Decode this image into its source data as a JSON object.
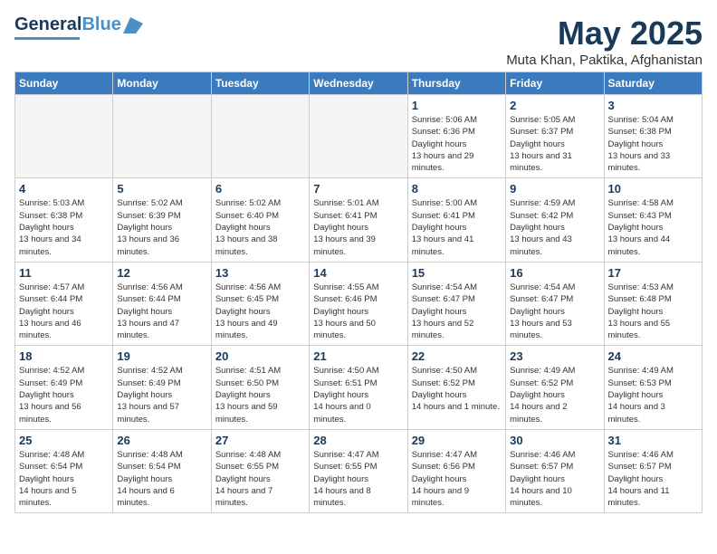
{
  "header": {
    "logo_general": "General",
    "logo_blue": "Blue",
    "month_title": "May 2025",
    "location": "Muta Khan, Paktika, Afghanistan"
  },
  "days_of_week": [
    "Sunday",
    "Monday",
    "Tuesday",
    "Wednesday",
    "Thursday",
    "Friday",
    "Saturday"
  ],
  "weeks": [
    [
      {
        "day": "",
        "empty": true
      },
      {
        "day": "",
        "empty": true
      },
      {
        "day": "",
        "empty": true
      },
      {
        "day": "",
        "empty": true
      },
      {
        "day": "1",
        "sunrise": "5:06 AM",
        "sunset": "6:36 PM",
        "daylight": "13 hours and 29 minutes."
      },
      {
        "day": "2",
        "sunrise": "5:05 AM",
        "sunset": "6:37 PM",
        "daylight": "13 hours and 31 minutes."
      },
      {
        "day": "3",
        "sunrise": "5:04 AM",
        "sunset": "6:38 PM",
        "daylight": "13 hours and 33 minutes."
      }
    ],
    [
      {
        "day": "4",
        "sunrise": "5:03 AM",
        "sunset": "6:38 PM",
        "daylight": "13 hours and 34 minutes."
      },
      {
        "day": "5",
        "sunrise": "5:02 AM",
        "sunset": "6:39 PM",
        "daylight": "13 hours and 36 minutes."
      },
      {
        "day": "6",
        "sunrise": "5:02 AM",
        "sunset": "6:40 PM",
        "daylight": "13 hours and 38 minutes."
      },
      {
        "day": "7",
        "sunrise": "5:01 AM",
        "sunset": "6:41 PM",
        "daylight": "13 hours and 39 minutes."
      },
      {
        "day": "8",
        "sunrise": "5:00 AM",
        "sunset": "6:41 PM",
        "daylight": "13 hours and 41 minutes."
      },
      {
        "day": "9",
        "sunrise": "4:59 AM",
        "sunset": "6:42 PM",
        "daylight": "13 hours and 43 minutes."
      },
      {
        "day": "10",
        "sunrise": "4:58 AM",
        "sunset": "6:43 PM",
        "daylight": "13 hours and 44 minutes."
      }
    ],
    [
      {
        "day": "11",
        "sunrise": "4:57 AM",
        "sunset": "6:44 PM",
        "daylight": "13 hours and 46 minutes."
      },
      {
        "day": "12",
        "sunrise": "4:56 AM",
        "sunset": "6:44 PM",
        "daylight": "13 hours and 47 minutes."
      },
      {
        "day": "13",
        "sunrise": "4:56 AM",
        "sunset": "6:45 PM",
        "daylight": "13 hours and 49 minutes."
      },
      {
        "day": "14",
        "sunrise": "4:55 AM",
        "sunset": "6:46 PM",
        "daylight": "13 hours and 50 minutes."
      },
      {
        "day": "15",
        "sunrise": "4:54 AM",
        "sunset": "6:47 PM",
        "daylight": "13 hours and 52 minutes."
      },
      {
        "day": "16",
        "sunrise": "4:54 AM",
        "sunset": "6:47 PM",
        "daylight": "13 hours and 53 minutes."
      },
      {
        "day": "17",
        "sunrise": "4:53 AM",
        "sunset": "6:48 PM",
        "daylight": "13 hours and 55 minutes."
      }
    ],
    [
      {
        "day": "18",
        "sunrise": "4:52 AM",
        "sunset": "6:49 PM",
        "daylight": "13 hours and 56 minutes."
      },
      {
        "day": "19",
        "sunrise": "4:52 AM",
        "sunset": "6:49 PM",
        "daylight": "13 hours and 57 minutes."
      },
      {
        "day": "20",
        "sunrise": "4:51 AM",
        "sunset": "6:50 PM",
        "daylight": "13 hours and 59 minutes."
      },
      {
        "day": "21",
        "sunrise": "4:50 AM",
        "sunset": "6:51 PM",
        "daylight": "14 hours and 0 minutes."
      },
      {
        "day": "22",
        "sunrise": "4:50 AM",
        "sunset": "6:52 PM",
        "daylight": "14 hours and 1 minute."
      },
      {
        "day": "23",
        "sunrise": "4:49 AM",
        "sunset": "6:52 PM",
        "daylight": "14 hours and 2 minutes."
      },
      {
        "day": "24",
        "sunrise": "4:49 AM",
        "sunset": "6:53 PM",
        "daylight": "14 hours and 3 minutes."
      }
    ],
    [
      {
        "day": "25",
        "sunrise": "4:48 AM",
        "sunset": "6:54 PM",
        "daylight": "14 hours and 5 minutes."
      },
      {
        "day": "26",
        "sunrise": "4:48 AM",
        "sunset": "6:54 PM",
        "daylight": "14 hours and 6 minutes."
      },
      {
        "day": "27",
        "sunrise": "4:48 AM",
        "sunset": "6:55 PM",
        "daylight": "14 hours and 7 minutes."
      },
      {
        "day": "28",
        "sunrise": "4:47 AM",
        "sunset": "6:55 PM",
        "daylight": "14 hours and 8 minutes."
      },
      {
        "day": "29",
        "sunrise": "4:47 AM",
        "sunset": "6:56 PM",
        "daylight": "14 hours and 9 minutes."
      },
      {
        "day": "30",
        "sunrise": "4:46 AM",
        "sunset": "6:57 PM",
        "daylight": "14 hours and 10 minutes."
      },
      {
        "day": "31",
        "sunrise": "4:46 AM",
        "sunset": "6:57 PM",
        "daylight": "14 hours and 11 minutes."
      }
    ]
  ]
}
